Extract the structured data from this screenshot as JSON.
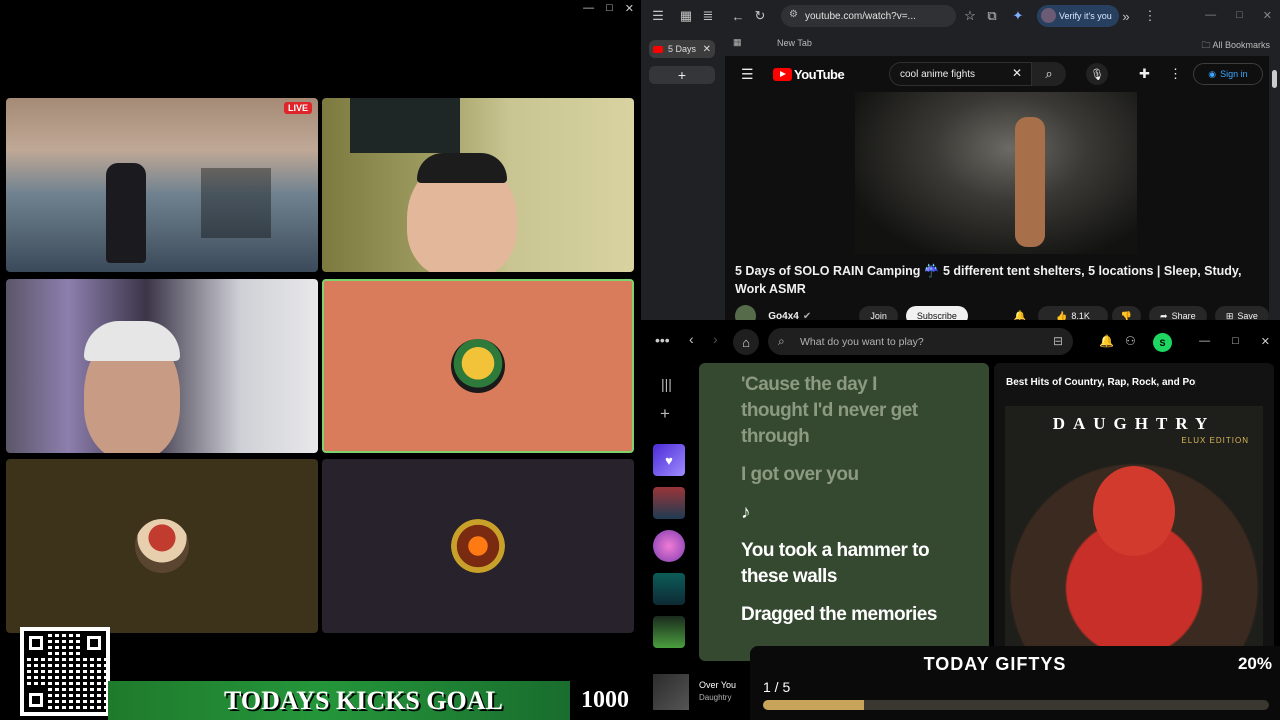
{
  "left": {
    "live_label": "LIVE",
    "kicks_label": "TODAYS KICKS GOAL",
    "kicks_value": "1000",
    "window_controls": [
      "—",
      "□",
      "✕"
    ]
  },
  "chrome": {
    "url": "youtube.com/watch?v=...",
    "verify_label": "Verify it's you",
    "tab_label": "5 Days",
    "newtab_label": "New Tab",
    "bookmarks_label": "All Bookmarks",
    "controls": [
      "—",
      "□",
      "✕"
    ]
  },
  "youtube": {
    "logo": "YouTube",
    "search_value": "cool anime fights",
    "signin_label": "Sign in",
    "title": "5 Days of SOLO RAIN Camping ☔ 5 different tent shelters, 5 locations | Sleep, Study, Work ASMR",
    "channel": "Go4x4",
    "join_label": "Join",
    "subscribe_label": "Subscribe",
    "likes": "8.1K",
    "share_label": "Share",
    "save_label": "Save"
  },
  "spotify": {
    "search_placeholder": "What do you want to play?",
    "avatar_letter": "S",
    "lyrics": [
      {
        "text": "'Cause the day I thought I'd never get through",
        "state": "past"
      },
      {
        "text": "I got over you",
        "state": "past"
      },
      {
        "text": "♪",
        "state": "cur"
      },
      {
        "text": "You took a hammer to these walls",
        "state": "cur"
      },
      {
        "text": "Dragged the memories",
        "state": "cur"
      }
    ],
    "playlist_title": "Best Hits of Country, Rap, Rock, and Pop",
    "album_artist": "DAUGHTRY",
    "album_edition": "ELUX EDITION",
    "now_playing_title": "Over You",
    "now_playing_artist": "Daughtry"
  },
  "goal": {
    "title": "TODAY GIFTYS",
    "percent": "20%",
    "percent_value": 0.2,
    "count": "1 / 5"
  },
  "colors": {
    "kicks_green": "#24963a",
    "spotify_green": "#1ed760",
    "lyrics_bg": "#354830",
    "yt_red": "#ff0000"
  }
}
